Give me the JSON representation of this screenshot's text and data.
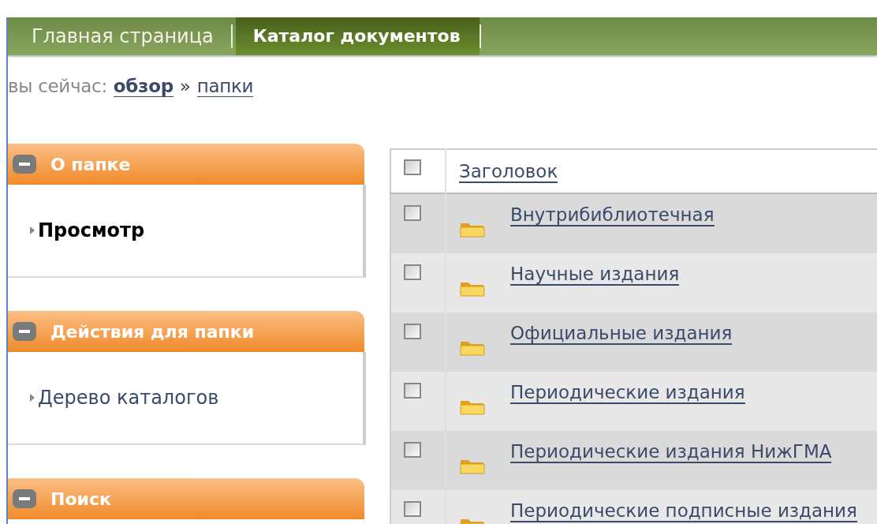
{
  "nav": {
    "tabs": [
      {
        "label": "Главная страница",
        "selected": false
      },
      {
        "label": "Каталог документов",
        "selected": true
      }
    ]
  },
  "breadcrumb": {
    "prefix": "вы сейчас:",
    "items": [
      {
        "label": "обзор",
        "current": true
      },
      {
        "label": "папки",
        "current": false
      }
    ],
    "separator": "»"
  },
  "sidebar": {
    "portlets": [
      {
        "title": "О папке",
        "expanded": true,
        "items": [
          {
            "label": "Просмотр",
            "selected": true
          }
        ]
      },
      {
        "title": "Действия для папки",
        "expanded": true,
        "items": [
          {
            "label": "Дерево каталогов",
            "selected": false
          }
        ]
      },
      {
        "title": "Поиск",
        "expanded": true
      }
    ]
  },
  "table": {
    "header": {
      "checked": false,
      "title": "Заголовок"
    },
    "rows": [
      {
        "checked": false,
        "title": "Внутрибиблиотечная"
      },
      {
        "checked": false,
        "title": "Научные издания"
      },
      {
        "checked": false,
        "title": "Официальные издания"
      },
      {
        "checked": false,
        "title": "Периодические издания"
      },
      {
        "checked": false,
        "title": "Периодические издания НижГМА"
      },
      {
        "checked": false,
        "title": "Периодические подписные издания"
      }
    ]
  }
}
